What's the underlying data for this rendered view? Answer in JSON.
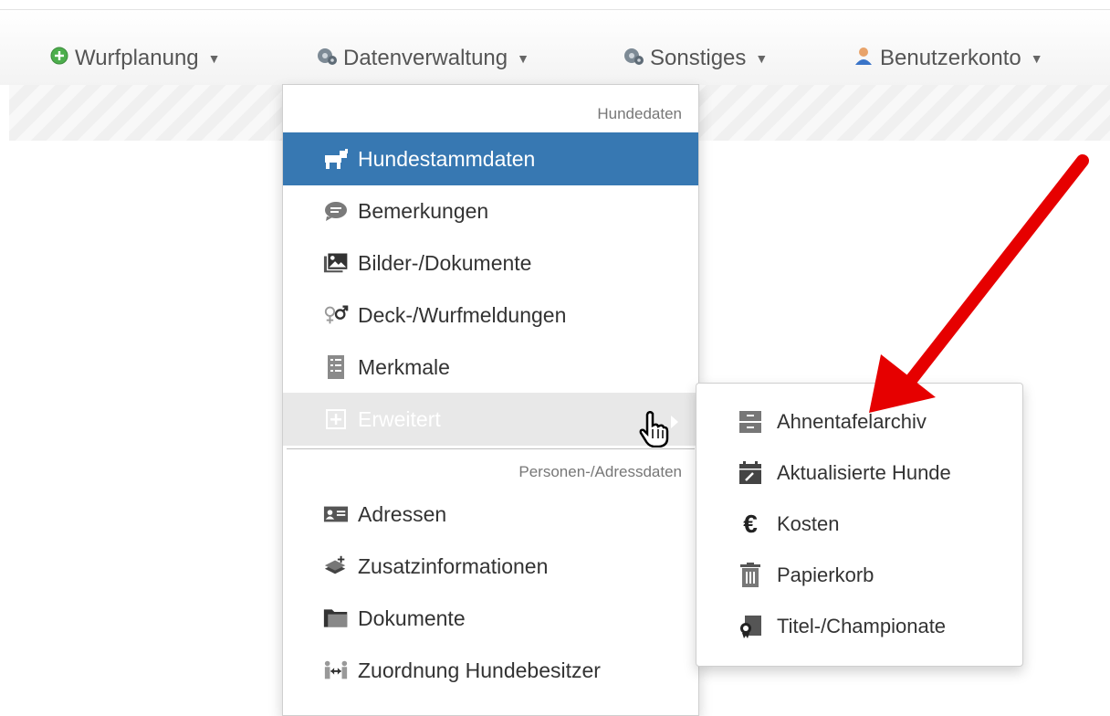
{
  "navbar": {
    "items": [
      {
        "label": "Wurfplanung",
        "icon": "plus-circle-icon"
      },
      {
        "label": "Datenverwaltung",
        "icon": "gears-icon"
      },
      {
        "label": "Sonstiges",
        "icon": "gears-icon"
      },
      {
        "label": "Benutzerkonto",
        "icon": "user-icon"
      }
    ]
  },
  "dropdown": {
    "section1_header": "Hundedaten",
    "items1": [
      {
        "label": "Hundestammdaten",
        "icon": "dog-icon"
      },
      {
        "label": "Bemerkungen",
        "icon": "comment-icon"
      },
      {
        "label": "Bilder-/Dokumente",
        "icon": "picture-icon"
      },
      {
        "label": "Deck-/Wurfmeldungen",
        "icon": "gender-icon"
      },
      {
        "label": "Merkmale",
        "icon": "list-icon"
      },
      {
        "label": "Erweitert",
        "icon": "plus-square-icon"
      }
    ],
    "section2_header": "Personen-/Adressdaten",
    "items2": [
      {
        "label": "Adressen",
        "icon": "address-card-icon"
      },
      {
        "label": "Zusatzinformationen",
        "icon": "layers-plus-icon"
      },
      {
        "label": "Dokumente",
        "icon": "folder-icon"
      },
      {
        "label": "Zuordnung Hundebesitzer",
        "icon": "link-people-icon"
      }
    ]
  },
  "submenu": {
    "items": [
      {
        "label": "Ahnentafelarchiv",
        "icon": "archive-icon"
      },
      {
        "label": "Aktualisierte Hunde",
        "icon": "calendar-edit-icon"
      },
      {
        "label": "Kosten",
        "icon": "euro-icon"
      },
      {
        "label": "Papierkorb",
        "icon": "trash-icon"
      },
      {
        "label": "Titel-/Championate",
        "icon": "certificate-icon"
      }
    ]
  },
  "colors": {
    "active_bg": "#3778b2",
    "hover_bg": "#e8e8e8",
    "annotation_arrow": "#e60000"
  }
}
